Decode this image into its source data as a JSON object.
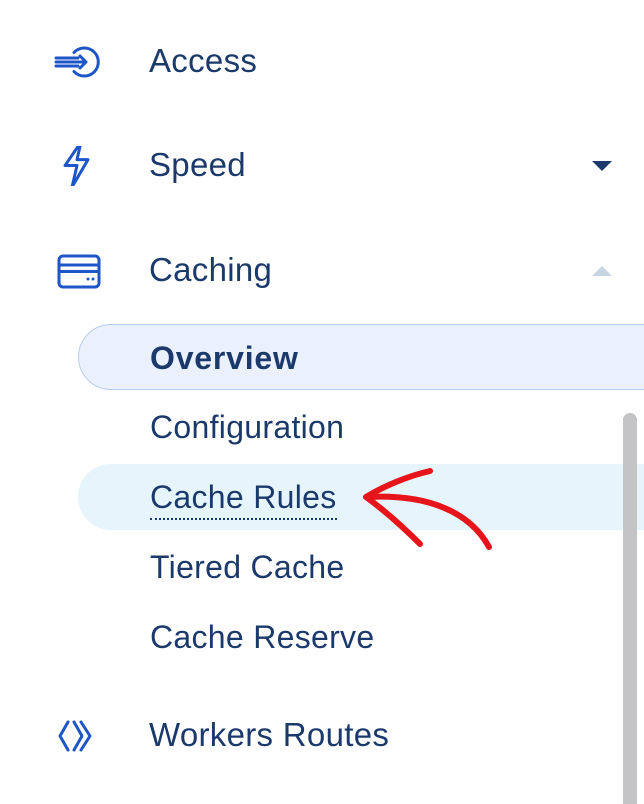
{
  "sidebar": {
    "items": [
      {
        "label": "Access",
        "icon": "access-icon",
        "expanded": null
      },
      {
        "label": "Speed",
        "icon": "speed-bolt-icon",
        "expanded": false
      },
      {
        "label": "Caching",
        "icon": "caching-drive-icon",
        "expanded": true
      },
      {
        "label": "Workers Routes",
        "icon": "workers-routes-icon",
        "expanded": null
      }
    ],
    "caching_subitems": [
      {
        "label": "Overview",
        "state": "active"
      },
      {
        "label": "Configuration",
        "state": "default"
      },
      {
        "label": "Cache Rules",
        "state": "hover"
      },
      {
        "label": "Tiered Cache",
        "state": "default"
      },
      {
        "label": "Cache Reserve",
        "state": "default"
      }
    ]
  },
  "colors": {
    "text": "#1b3a6b",
    "icon_blue": "#1e56c8",
    "active_bg": "#eaf1fc",
    "active_border": "#b8cdee",
    "hover_bg": "#e6f4fb",
    "annotation_red": "#e8141b",
    "scrollbar": "#c4c4c6"
  }
}
